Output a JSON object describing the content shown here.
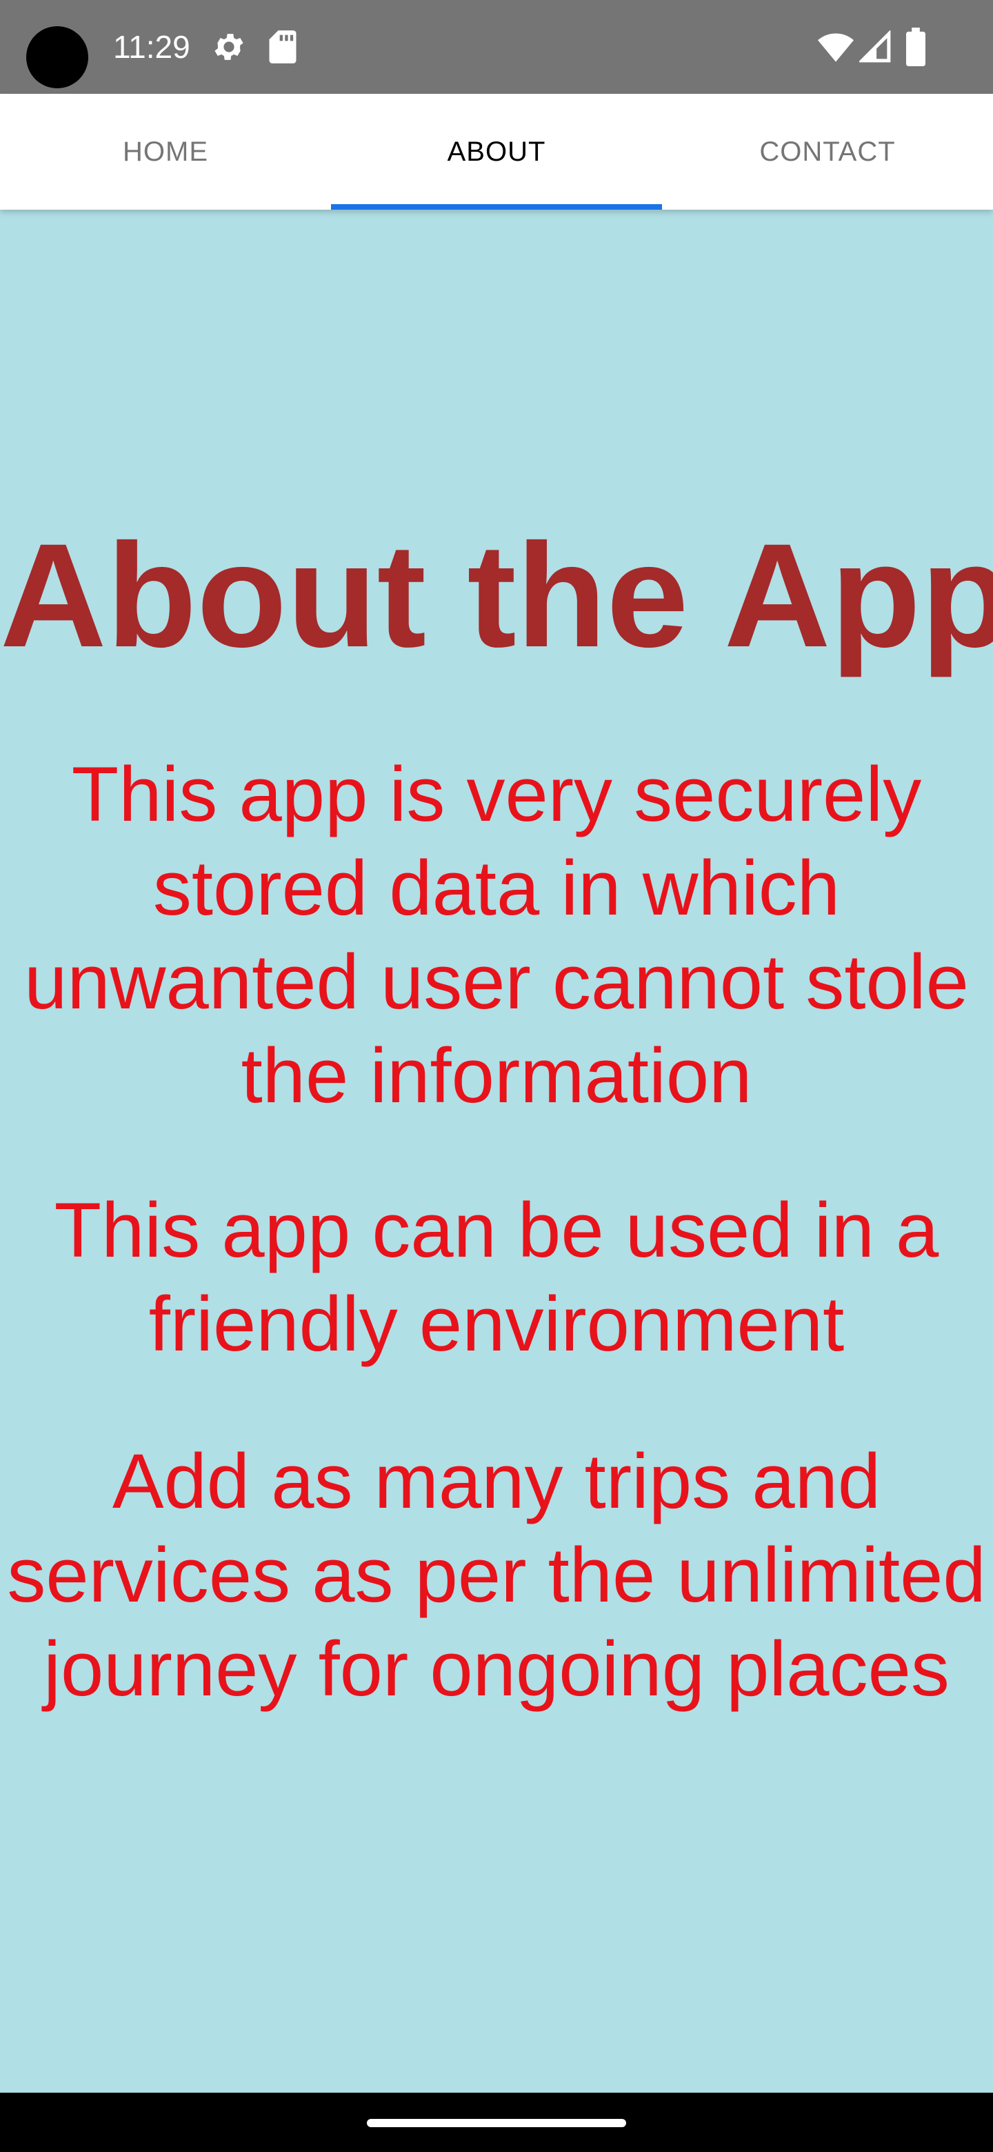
{
  "status_bar": {
    "time": "11:29",
    "icons": [
      "gear-icon",
      "sd-card-icon",
      "wifi-icon",
      "cell-signal-icon",
      "battery-icon"
    ]
  },
  "tabs": [
    {
      "label": "HOME",
      "active": false
    },
    {
      "label": "ABOUT",
      "active": true
    },
    {
      "label": "CONTACT",
      "active": false
    }
  ],
  "about": {
    "title": "About the App",
    "paragraphs": [
      "This app is very securely stored data in which unwanted user cannot stole the information",
      "This app can be used in a friendly environment",
      "Add as many trips and services as per the unlimited journey for ongoing places"
    ]
  },
  "colors": {
    "background": "#b0dfe5",
    "title": "#a52a2a",
    "body_text": "#e8121b",
    "tab_indicator": "#1a73e8",
    "status_bar": "#757575"
  }
}
